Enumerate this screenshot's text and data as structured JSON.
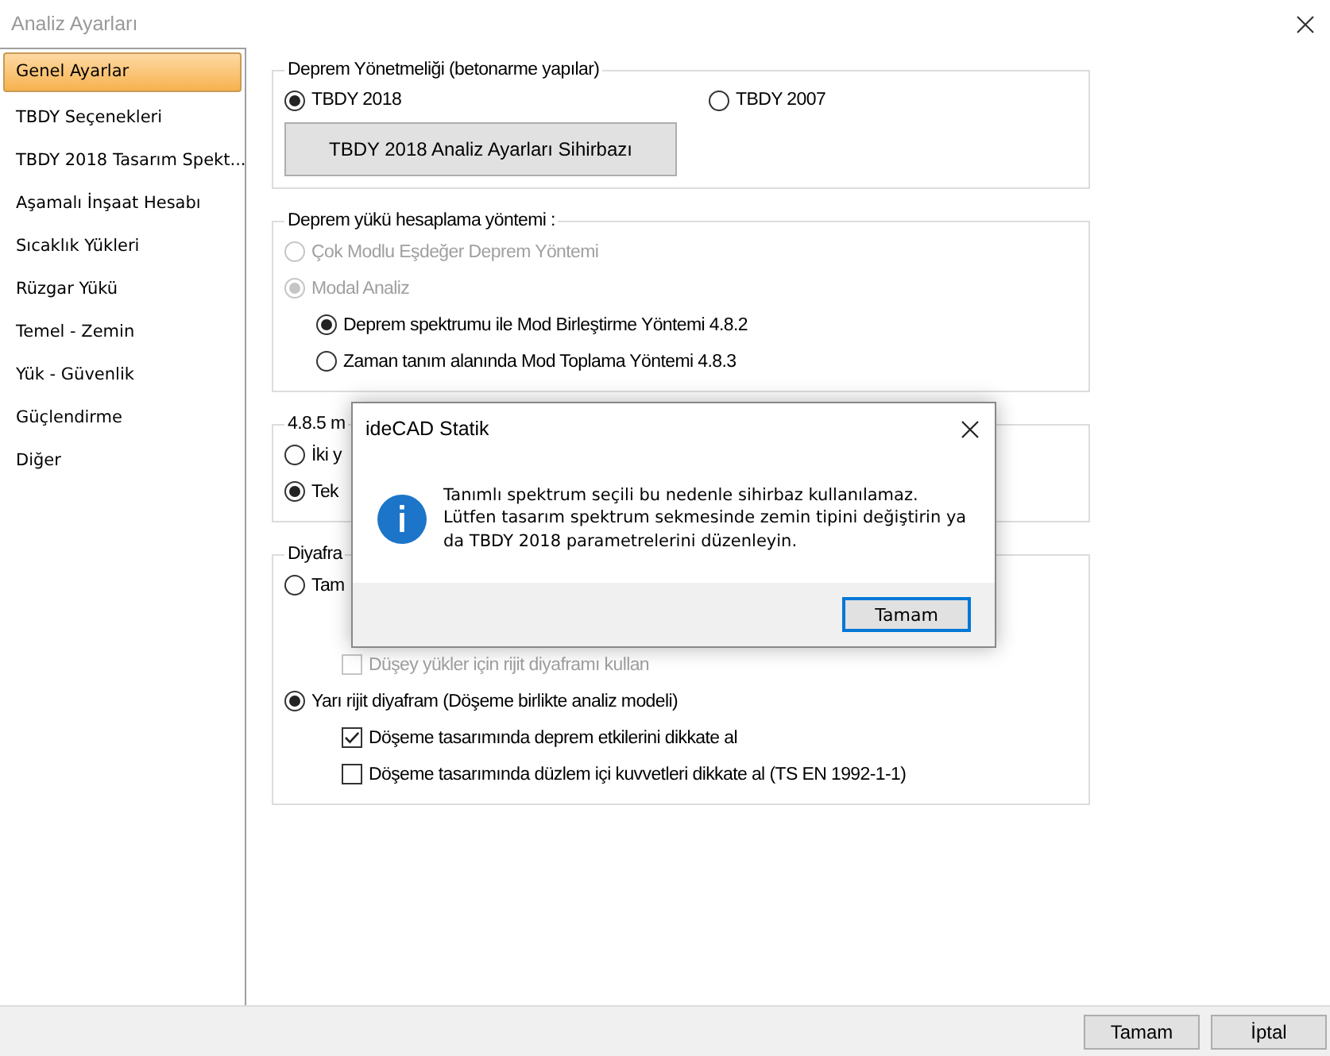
{
  "window": {
    "title": "Analiz Ayarları"
  },
  "sidebar": {
    "items": [
      {
        "label": "Genel Ayarlar",
        "selected": true
      },
      {
        "label": "TBDY Seçenekleri",
        "selected": false
      },
      {
        "label": "TBDY 2018 Tasarım Spekt...",
        "selected": false
      },
      {
        "label": "Aşamalı İnşaat Hesabı",
        "selected": false
      },
      {
        "label": "Sıcaklık Yükleri",
        "selected": false
      },
      {
        "label": "Rüzgar Yükü",
        "selected": false
      },
      {
        "label": "Temel - Zemin",
        "selected": false
      },
      {
        "label": "Yük - Güvenlik",
        "selected": false
      },
      {
        "label": "Güçlendirme",
        "selected": false
      },
      {
        "label": "Diğer",
        "selected": false
      }
    ]
  },
  "regulation": {
    "legend": "Deprem Yönetmeliği (betonarme yapılar)",
    "options": [
      {
        "label": "TBDY 2018",
        "selected": true
      },
      {
        "label": "TBDY 2007",
        "selected": false
      }
    ],
    "wizard_button": "TBDY 2018 Analiz Ayarları Sihirbazı"
  },
  "groups": [
    {
      "legend": "Deprem yükü hesaplama yöntemi :",
      "items": [
        {
          "kind": "radio",
          "label": "Çok Modlu Eşdeğer Deprem Yöntemi",
          "selected": false,
          "disabled": true
        },
        {
          "kind": "radio",
          "label": "Modal Analiz",
          "selected": true,
          "disabled": true,
          "children": [
            {
              "kind": "radio",
              "label": "Deprem spektrumu ile Mod Birleştirme Yöntemi 4.8.2",
              "selected": true,
              "disabled": false
            },
            {
              "kind": "radio",
              "label": "Zaman tanım alanında Mod Toplama Yöntemi 4.8.3",
              "selected": false,
              "disabled": false
            }
          ]
        }
      ]
    },
    {
      "legend": "4.8.5 m",
      "items": [
        {
          "kind": "radio",
          "label": "İki y",
          "selected": false,
          "disabled": false
        },
        {
          "kind": "radio",
          "label": "Tek",
          "selected": true,
          "disabled": false
        }
      ]
    },
    {
      "legend": "Diyafra",
      "items": [
        {
          "kind": "radio",
          "label": "Tam",
          "selected": false,
          "disabled": false,
          "children": [
            {
              "kind": "checkbox",
              "label": "Düşey yükler için rijit diyaframı kullan",
              "checked": false,
              "disabled": true
            }
          ]
        },
        {
          "kind": "radio",
          "label": "Yarı rijit diyafram (Döşeme birlikte analiz modeli)",
          "selected": true,
          "disabled": false,
          "children": [
            {
              "kind": "checkbox",
              "label": "Döşeme tasarımında deprem etkilerini dikkate al",
              "checked": true,
              "disabled": false
            },
            {
              "kind": "checkbox",
              "label": "Döşeme tasarımında düzlem içi kuvvetleri dikkate al (TS EN 1992-1-1)",
              "checked": false,
              "disabled": false
            }
          ]
        }
      ]
    }
  ],
  "dialog": {
    "title": "ideCAD Statik",
    "message": "Tanımlı spektrum seçili bu nedenle sihirbaz kullanılamaz.\nLütfen tasarım spektrum sekmesinde zemin tipini değiştirin ya\nda TBDY 2018 parametrelerini düzenleyin.",
    "button": "Tamam"
  },
  "footer": {
    "buttons": [
      "Tamam",
      "İptal"
    ]
  }
}
